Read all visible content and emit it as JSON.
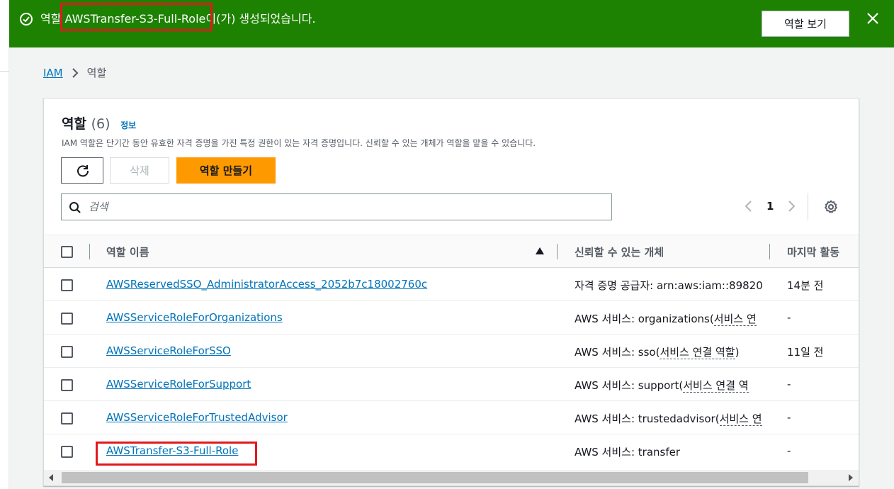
{
  "flash": {
    "prefix": "역할 ",
    "role_name": "AWSTransfer-S3-Full-Role",
    "suffix": "이(가) 생성되었습니다.",
    "view_button": "역할 보기",
    "status_color": "#1d8102"
  },
  "breadcrumb": {
    "root": "IAM",
    "current": "역할"
  },
  "card": {
    "title": "역할",
    "count": "(6)",
    "info_link": "정보",
    "description": "IAM 역할은 단기간 동안 유효한 자격 증명을 가진 특정 권한이 있는 자격 증명입니다. 신뢰할 수 있는 개체가 역할을 맡을 수 있습니다.",
    "delete_button": "삭제",
    "create_button": "역할 만들기",
    "accent_color": "#ff9900"
  },
  "search": {
    "placeholder": "검색"
  },
  "pagination": {
    "current_page": "1"
  },
  "table": {
    "columns": [
      "역할 이름",
      "신뢰할 수 있는 개체",
      "마지막 활동"
    ],
    "rows": [
      {
        "name": "AWSReservedSSO_AdministratorAccess_2052b7c18002760c",
        "trust": "자격 증명 공급자: arn:aws:iam::89820",
        "trust_link": "",
        "trust_suffix": "",
        "last": "14분 전"
      },
      {
        "name": "AWSServiceRoleForOrganizations",
        "trust": "AWS 서비스: organizations",
        "trust_link": "서비스 연",
        "trust_suffix": "",
        "last": "-"
      },
      {
        "name": "AWSServiceRoleForSSO",
        "trust": "AWS 서비스: sso",
        "trust_link": "서비스 연결 역할",
        "trust_suffix": ")",
        "last": "11일 전"
      },
      {
        "name": "AWSServiceRoleForSupport",
        "trust": "AWS 서비스: support",
        "trust_link": "서비스 연결 역",
        "trust_suffix": "",
        "last": "-"
      },
      {
        "name": "AWSServiceRoleForTrustedAdvisor",
        "trust": "AWS 서비스: trustedadvisor",
        "trust_link": "서비스 연",
        "trust_suffix": "",
        "last": "-"
      },
      {
        "name": "AWSTransfer-S3-Full-Role",
        "trust": "AWS 서비스: transfer",
        "trust_link": "",
        "trust_suffix": "",
        "last": "-"
      }
    ]
  }
}
